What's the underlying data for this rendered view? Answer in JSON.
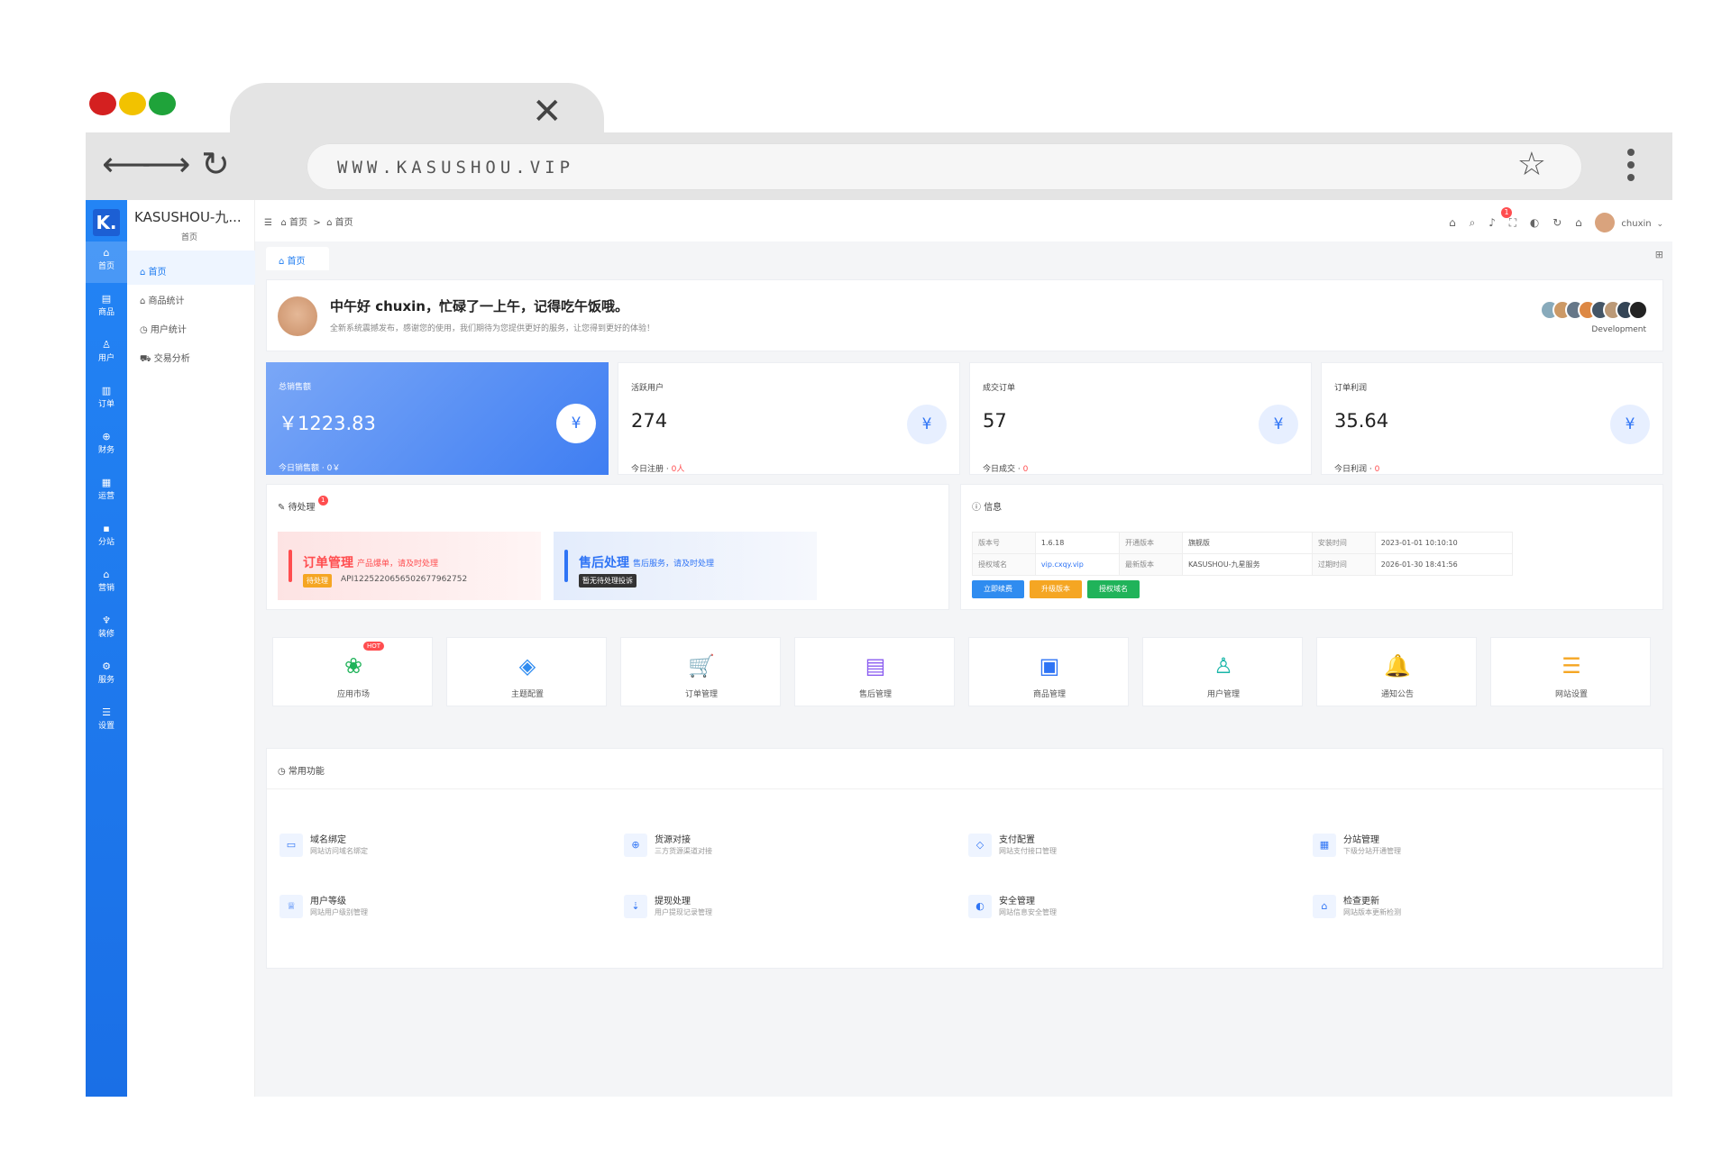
{
  "browser": {
    "url": "WWW.KASUSHOU.VIP",
    "tab_close": "✕",
    "colors": {
      "red": "#d42020",
      "yellow": "#f2c200",
      "green": "#1fa33a"
    }
  },
  "app": {
    "logo": "K.",
    "site_title": "KASUSHOU-九...",
    "site_subtitle": "首页",
    "rail": [
      {
        "icon": "home-icon",
        "label": "首页",
        "active": true
      },
      {
        "icon": "goods-icon",
        "label": "商品"
      },
      {
        "icon": "user-icon",
        "label": "用户"
      },
      {
        "icon": "order-icon",
        "label": "订单"
      },
      {
        "icon": "finance-icon",
        "label": "财务"
      },
      {
        "icon": "operation-icon",
        "label": "运营"
      },
      {
        "icon": "branch-icon",
        "label": "分站"
      },
      {
        "icon": "marketing-icon",
        "label": "营销"
      },
      {
        "icon": "decoration-icon",
        "label": "装修"
      },
      {
        "icon": "service-icon",
        "label": "服务"
      },
      {
        "icon": "settings-icon",
        "label": "设置"
      }
    ],
    "submenu": [
      {
        "label": "首页",
        "active": true
      },
      {
        "label": "商品统计"
      },
      {
        "label": "用户统计"
      },
      {
        "label": "交易分析"
      }
    ],
    "breadcrumb": [
      "首页",
      "首页"
    ],
    "user": "chuxin",
    "notification_count": "1",
    "tab": "首页"
  },
  "welcome": {
    "title": "中午好 chuxin，忙碌了一上午，记得吃午饭哦。",
    "subtitle": "全新系统震撼发布，感谢您的使用，我们期待为您提供更好的服务，让您得到更好的体验！",
    "team_label": "Development"
  },
  "stats": [
    {
      "label": "总销售额",
      "value": "￥1223.83",
      "sub_label": "今日销售额",
      "sub_value": "0￥"
    },
    {
      "label": "活跃用户",
      "value": "274",
      "sub_label": "今日注册",
      "sub_value": "0人"
    },
    {
      "label": "成交订单",
      "value": "57",
      "sub_label": "今日成交",
      "sub_value": "0"
    },
    {
      "label": "订单利润",
      "value": "35.64",
      "sub_label": "今日利润",
      "sub_value": "0"
    }
  ],
  "pending": {
    "title": "待处理",
    "badge": "1",
    "order": {
      "title": "订单管理",
      "desc": "产品爆单，请及时处理",
      "tag": "待处理",
      "code": "API12252206565026779​62752"
    },
    "aftersale": {
      "title": "售后处理",
      "desc": "售后服务，请及时处理",
      "tag": "暂无待处理投诉"
    }
  },
  "info": {
    "title": "信息",
    "rows": [
      [
        "版本号",
        "1.6.18",
        "开通版本",
        "旗舰版",
        "安装时间",
        "2023-01-01 10:10:10"
      ],
      [
        "授权域名",
        "vip.cxqy.vip",
        "最新版本",
        "KASUSHOU-九星服务",
        "过期时间",
        "2026-01-30 18:41:56"
      ]
    ],
    "buttons": [
      "立即续费",
      "升级版本",
      "授权域名"
    ]
  },
  "quick": [
    {
      "icon": "app-market-icon",
      "glyph": "❀",
      "label": "应用市场",
      "color": "#20b35a",
      "hot": "HOT"
    },
    {
      "icon": "theme-icon",
      "glyph": "◈",
      "label": "主题配置",
      "color": "#2f8cf0"
    },
    {
      "icon": "cart-icon",
      "glyph": "🛒",
      "label": "订单管理",
      "color": "#f5a623"
    },
    {
      "icon": "aftersale-icon",
      "glyph": "▤",
      "label": "售后管理",
      "color": "#8a5cf0"
    },
    {
      "icon": "goods-box-icon",
      "glyph": "▣",
      "label": "商品管理",
      "color": "#2f74f5"
    },
    {
      "icon": "user-manage-icon",
      "glyph": "♙",
      "label": "用户管理",
      "color": "#19b6a8"
    },
    {
      "icon": "bell-icon",
      "glyph": "🔔",
      "label": "通知公告",
      "color": "#ec4fa0"
    },
    {
      "icon": "site-settings-icon",
      "glyph": "☰",
      "label": "网站设置",
      "color": "#f5a623"
    }
  ],
  "common": {
    "title": "常用功能",
    "items": [
      {
        "icon": "domain-icon",
        "title": "域名绑定",
        "desc": "网站访问域名绑定"
      },
      {
        "icon": "source-icon",
        "title": "货源对接",
        "desc": "三方货源渠道对接"
      },
      {
        "icon": "payment-icon",
        "title": "支付配置",
        "desc": "网站支付接口管理"
      },
      {
        "icon": "branch-manage-icon",
        "title": "分站管理",
        "desc": "下级分站开通管理"
      },
      {
        "icon": "level-icon",
        "title": "用户等级",
        "desc": "网站用户级别管理"
      },
      {
        "icon": "withdraw-icon",
        "title": "提现处理",
        "desc": "用户提现记录管理"
      },
      {
        "icon": "security-icon",
        "title": "安全管理",
        "desc": "网站信息安全管理"
      },
      {
        "icon": "update-icon",
        "title": "检查更新",
        "desc": "网站版本更新检测"
      }
    ]
  }
}
